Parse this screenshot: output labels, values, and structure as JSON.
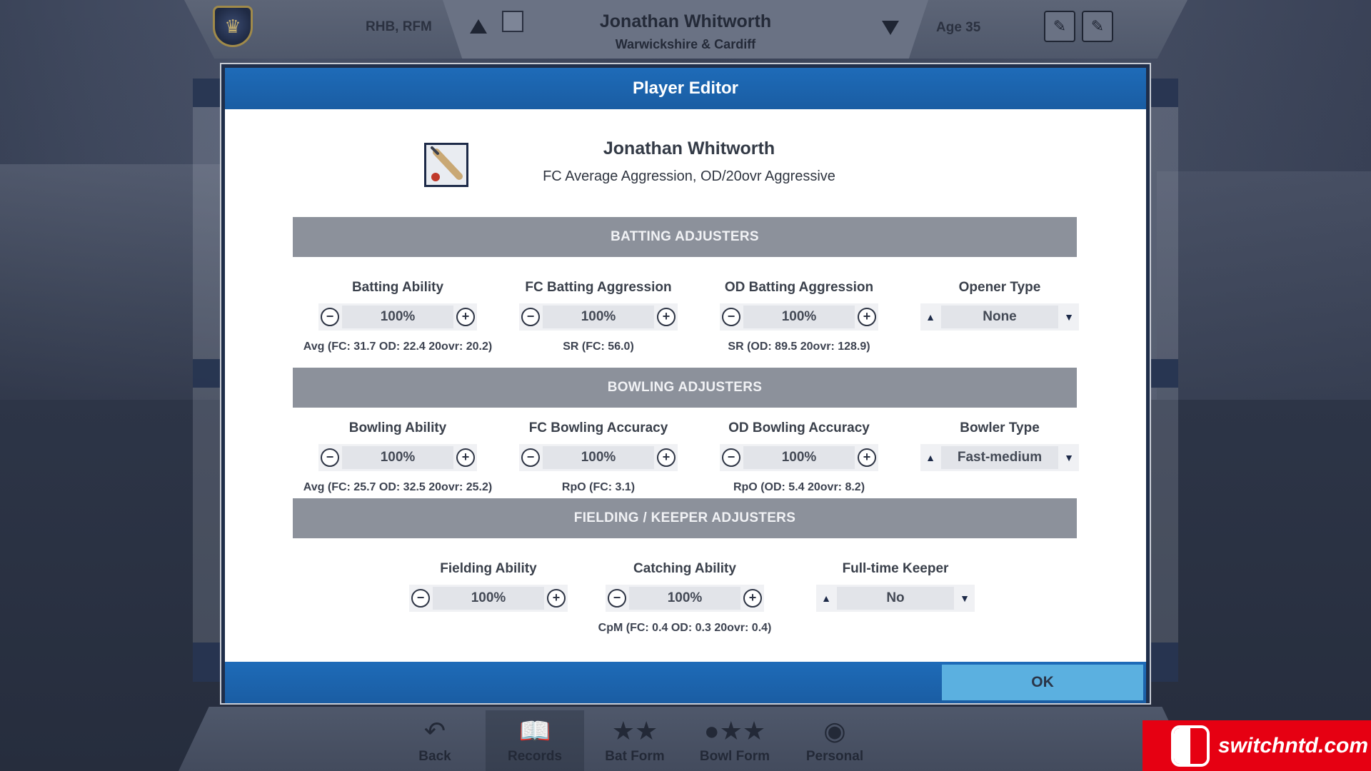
{
  "top_bar": {
    "role": "RHB, RFM",
    "name": "Jonathan Whitworth",
    "club": "Warwickshire & Cardiff",
    "age": "Age 35"
  },
  "modal": {
    "title": "Player Editor",
    "player_name": "Jonathan Whitworth",
    "player_style": "FC Average Aggression, OD/20ovr Aggressive",
    "ok_label": "OK",
    "sections": {
      "batting": {
        "header": "BATTING ADJUSTERS",
        "items": [
          {
            "label": "Batting Ability",
            "value": "100%",
            "stat": "Avg (FC: 31.7  OD: 22.4  20ovr: 20.2)"
          },
          {
            "label": "FC Batting Aggression",
            "value": "100%",
            "stat": "SR (FC: 56.0)"
          },
          {
            "label": "OD Batting Aggression",
            "value": "100%",
            "stat": "SR (OD: 89.5  20ovr: 128.9)"
          },
          {
            "label": "Opener Type",
            "value": "None"
          }
        ]
      },
      "bowling": {
        "header": "BOWLING ADJUSTERS",
        "items": [
          {
            "label": "Bowling Ability",
            "value": "100%",
            "stat": "Avg (FC: 25.7  OD: 32.5  20ovr: 25.2)"
          },
          {
            "label": "FC Bowling Accuracy",
            "value": "100%",
            "stat": "RpO (FC: 3.1)"
          },
          {
            "label": "OD Bowling Accuracy",
            "value": "100%",
            "stat": "RpO (OD: 5.4  20ovr: 8.2)"
          },
          {
            "label": "Bowler Type",
            "value": "Fast-medium"
          }
        ]
      },
      "fielding": {
        "header": "FIELDING / KEEPER ADJUSTERS",
        "items": [
          {
            "label": "Fielding Ability",
            "value": "100%"
          },
          {
            "label": "Catching Ability",
            "value": "100%",
            "stat": "CpM (FC: 0.4  OD: 0.3  20ovr: 0.4)"
          },
          {
            "label": "Full-time Keeper",
            "value": "No"
          }
        ]
      }
    }
  },
  "bottom_nav": {
    "items": [
      {
        "label": "Back",
        "icon": "back-arrow-icon"
      },
      {
        "label": "Records",
        "icon": "records-book-icon"
      },
      {
        "label": "Bat Form",
        "icon": "bat-form-icon"
      },
      {
        "label": "Bowl Form",
        "icon": "bowl-form-icon"
      },
      {
        "label": "Personal",
        "icon": "personal-helmet-icon"
      }
    ]
  },
  "watermark": {
    "text": "switchntd.com"
  },
  "colors": {
    "header_blue": "#1e6bb8",
    "ok_button": "#5bb0e0",
    "section_grey": "#8c919b",
    "watermark_red": "#e60012"
  }
}
